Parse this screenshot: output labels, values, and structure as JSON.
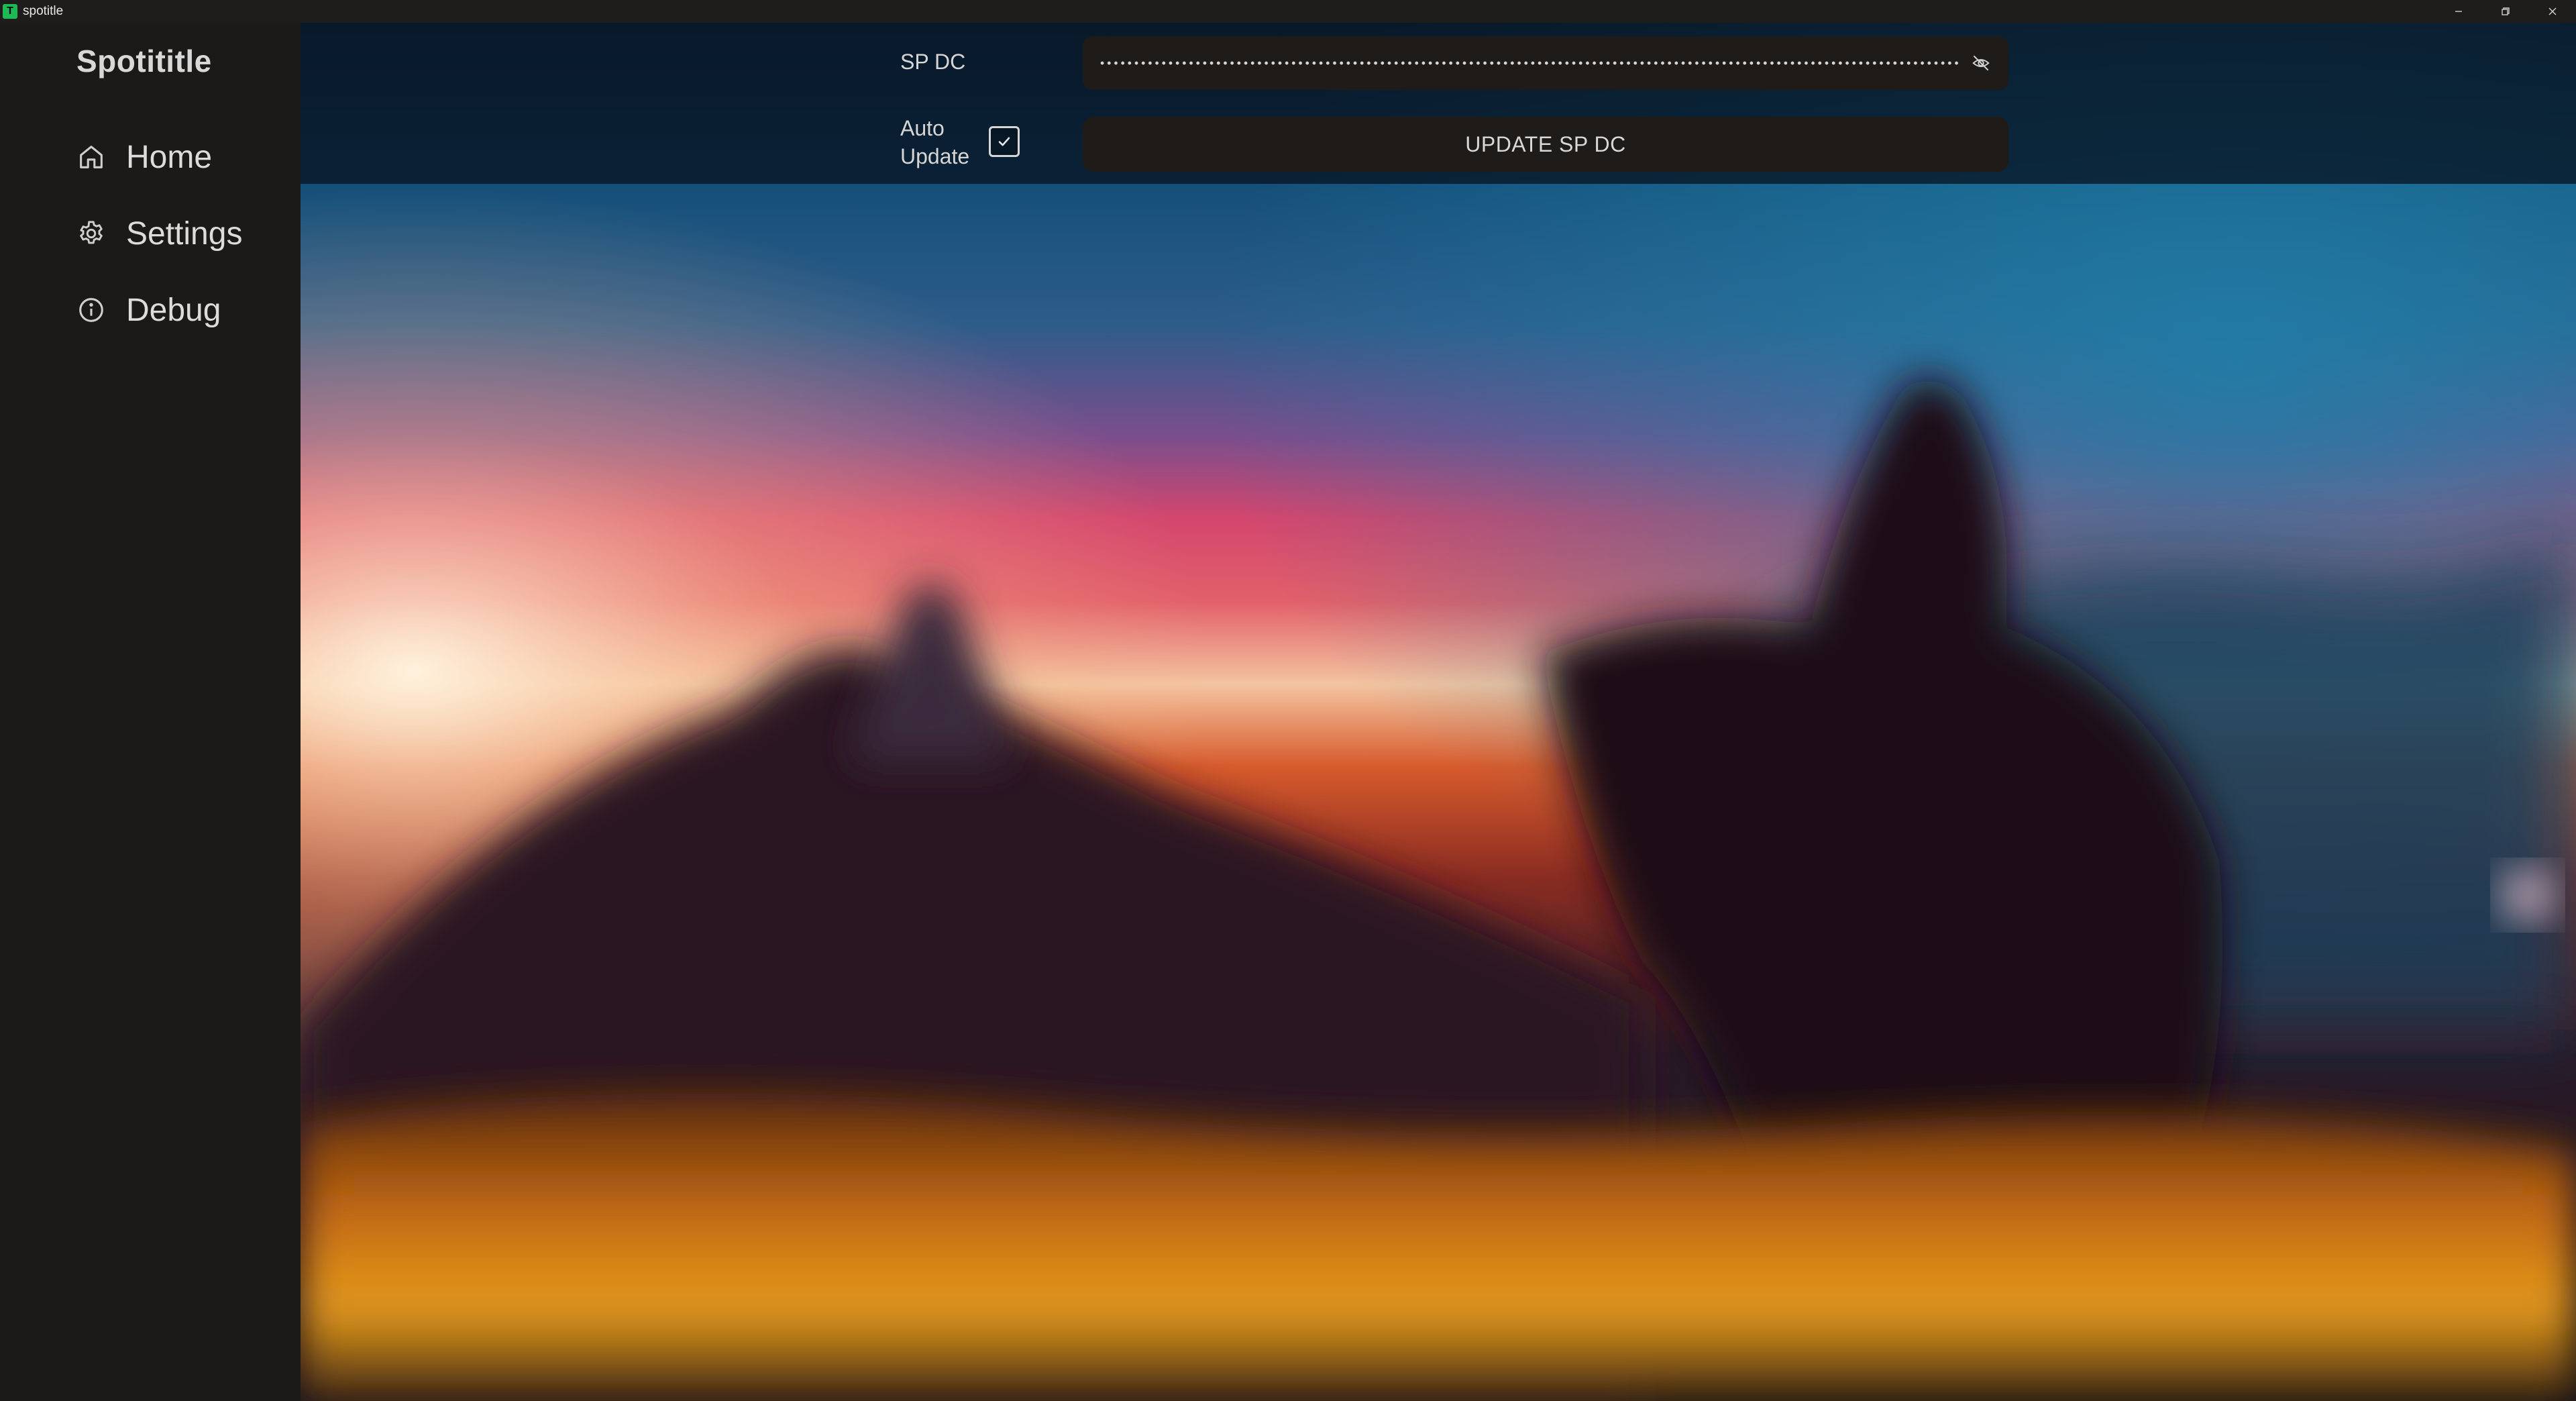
{
  "window": {
    "title": "spotitle",
    "icon_letter": "T",
    "icon_color": "#1db954"
  },
  "sidebar": {
    "brand": "Spotititle",
    "items": [
      {
        "label": "Home",
        "icon": "home-icon"
      },
      {
        "label": "Settings",
        "icon": "gear-icon"
      },
      {
        "label": "Debug",
        "icon": "info-icon"
      }
    ]
  },
  "settings_panel": {
    "sp_dc_label": "SP DC",
    "sp_dc_value_masked": true,
    "auto_update_label": "Auto Update",
    "auto_update_checked": true,
    "update_button_label": "UPDATE SP DC"
  },
  "background": {
    "description_colors": [
      "#0d3a5c",
      "#e0446a",
      "#f7d6a0",
      "#c2401a",
      "#f0a020"
    ]
  }
}
